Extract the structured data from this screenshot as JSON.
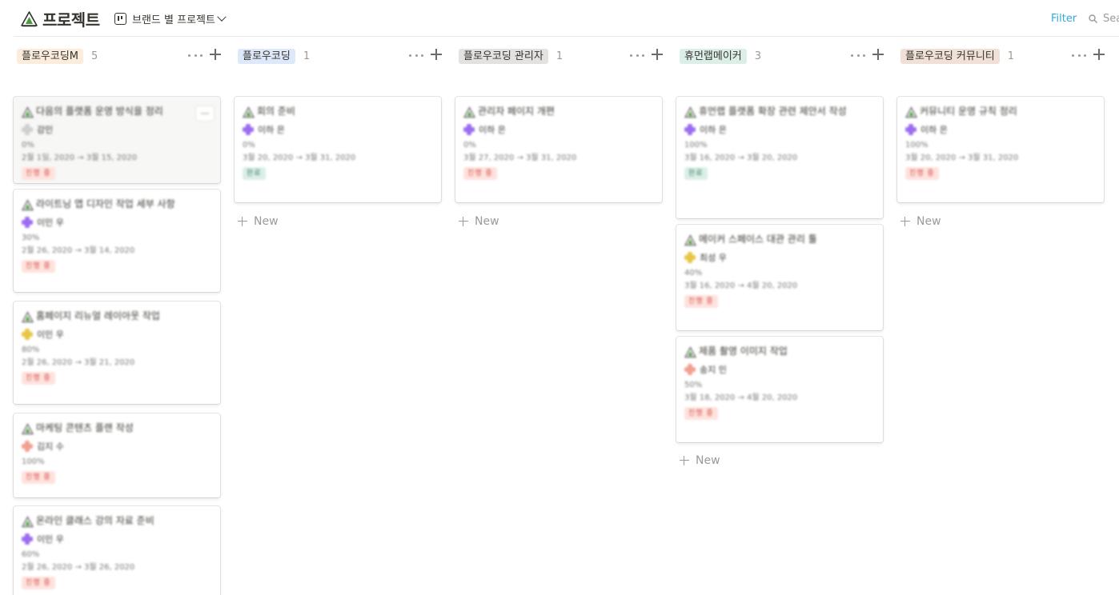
{
  "header": {
    "title": "프로젝트",
    "title_icon": "mountain-tent-icon",
    "view_label": "브랜드 별 프로젝트",
    "filter_label": "Filter",
    "search_placeholder": "Sea"
  },
  "new_label": "New",
  "columns": [
    {
      "key": "c1",
      "name": "플로우코딩M",
      "count": "5",
      "tag_color": "#fbecdd",
      "cards": [
        {
          "title": "다음의 플랫폼 운영 방식을 정리",
          "person": "강민",
          "avatar_color": "#cfcfcf",
          "pct": "0%",
          "date": "2월 1일, 2020 → 3월 15, 2020",
          "badge": "진행 중",
          "badge_bg": "#ffe2dd",
          "badge_fg": "#d44c47",
          "hover": true
        },
        {
          "title": "라이트닝 앱 디자인 작업 세부 사항",
          "person": "이민 우",
          "avatar_color": "#9b6cf0",
          "pct": "30%",
          "date": "2월 26, 2020 → 3월 14, 2020",
          "badge": "진행 중",
          "badge_bg": "#ffe2dd",
          "badge_fg": "#d44c47"
        },
        {
          "title": "홈페이지 리뉴얼 레이아웃 작업",
          "person": "이민 우",
          "avatar_color": "#e8c545",
          "pct": "80%",
          "date": "2월 26, 2020 → 3월 21, 2020",
          "badge": "진행 중",
          "badge_bg": "#ffe2dd",
          "badge_fg": "#d44c47"
        },
        {
          "title": "마케팅 콘텐츠 플랜 작성",
          "person": "김지 수",
          "avatar_color": "#f0a090",
          "pct": "100%",
          "date": "",
          "badge": "진행 중",
          "badge_bg": "#ffe2dd",
          "badge_fg": "#d44c47"
        },
        {
          "title": "온라인 클래스 강의 자료 준비",
          "person": "이민 우",
          "avatar_color": "#9b6cf0",
          "pct": "60%",
          "date": "2월 26, 2020 → 3월 26, 2020",
          "badge": "진행 중",
          "badge_bg": "#ffe2dd",
          "badge_fg": "#d44c47"
        }
      ]
    },
    {
      "key": "c2",
      "name": "플로우코딩",
      "count": "1",
      "tag_color": "#dde8fb",
      "cards": [
        {
          "title": "회의 준비",
          "person": "이하 은",
          "avatar_color": "#9b6cf0",
          "pct": "0%",
          "date": "3월 20, 2020 → 3월 31, 2020",
          "badge": "완료",
          "badge_bg": "#dbeee8",
          "badge_fg": "#448361"
        }
      ]
    },
    {
      "key": "c3",
      "name": "플로우코딩 관리자",
      "count": "1",
      "tag_color": "#e3e2e0",
      "cards": [
        {
          "title": "관리자 페이지 개편",
          "person": "이하 은",
          "avatar_color": "#9b6cf0",
          "pct": "0%",
          "date": "3월 27, 2020 → 3월 31, 2020",
          "badge": "진행 중",
          "badge_bg": "#ffe2dd",
          "badge_fg": "#d44c47"
        }
      ]
    },
    {
      "key": "c4",
      "name": "휴먼랩메이커",
      "count": "3",
      "tag_color": "#dbeee8",
      "cards": [
        {
          "title": "휴먼랩 플랫폼 확장 관련 제안서 작성",
          "person": "이하 은",
          "avatar_color": "#9b6cf0",
          "pct": "100%",
          "date": "3월 16, 2020 → 3월 20, 2020",
          "badge": "완료",
          "badge_bg": "#dbeee8",
          "badge_fg": "#448361"
        },
        {
          "title": "메이커 스페이스 대관 관리 툴",
          "person": "최성 우",
          "avatar_color": "#e8c545",
          "pct": "40%",
          "date": "3월 16, 2020 → 4월 20, 2020",
          "badge": "진행 중",
          "badge_bg": "#ffe2dd",
          "badge_fg": "#d44c47"
        },
        {
          "title": "제품 촬영 이미지 작업",
          "person": "송지 민",
          "avatar_color": "#f0a090",
          "pct": "50%",
          "date": "3월 18, 2020 → 4월 20, 2020",
          "badge": "진행 중",
          "badge_bg": "#ffe2dd",
          "badge_fg": "#d44c47"
        }
      ]
    },
    {
      "key": "c5",
      "name": "플로우코딩 커뮤니티",
      "count": "1",
      "tag_color": "#f0e0d8",
      "cards": [
        {
          "title": "커뮤니티 운영 규칙 정리",
          "person": "이하 은",
          "avatar_color": "#9b6cf0",
          "pct": "100%",
          "date": "3월 20, 2020 → 3월 31, 2020",
          "badge": "진행 중",
          "badge_bg": "#ffe2dd",
          "badge_fg": "#d44c47"
        }
      ]
    }
  ]
}
